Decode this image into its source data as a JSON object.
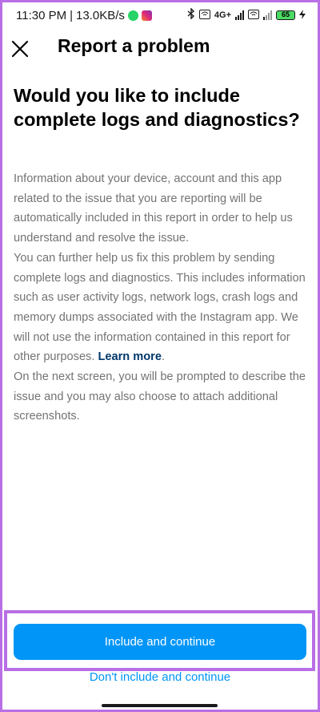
{
  "status_bar": {
    "time": "11:30 PM",
    "separator": "|",
    "network_speed": "13.0KB/s",
    "network_type": "4G+",
    "battery": "65",
    "icons": [
      "whatsapp-icon",
      "instagram-icon",
      "bluetooth-icon",
      "vowifi-icon",
      "signal-icon",
      "battery-icon",
      "charging-icon"
    ]
  },
  "header": {
    "title": "Report a problem",
    "close_icon": "close-icon"
  },
  "content": {
    "headline": "Would you like to include complete logs and diagnostics?",
    "paragraph1": "Information about your device, account and this app related to the issue that you are reporting will be automatically included in this report in order to help us understand and resolve the issue.",
    "paragraph2": "You can further help us fix this problem by sending complete logs and diagnostics. This includes information such as user activity logs, network logs, crash logs and memory dumps associated with the Instagram app. We will not use the information contained in this report for other purposes.",
    "learn_more": "Learn more",
    "period": ".",
    "paragraph3": "On the next screen, you will be prompted to describe the issue and you may also choose to attach additional screenshots."
  },
  "actions": {
    "primary_label": "Include and continue",
    "secondary_label": "Don't include and continue"
  },
  "colors": {
    "primary": "#0095f6",
    "link": "#00376b",
    "highlight": "#b96ee6",
    "body_text": "#737373"
  }
}
